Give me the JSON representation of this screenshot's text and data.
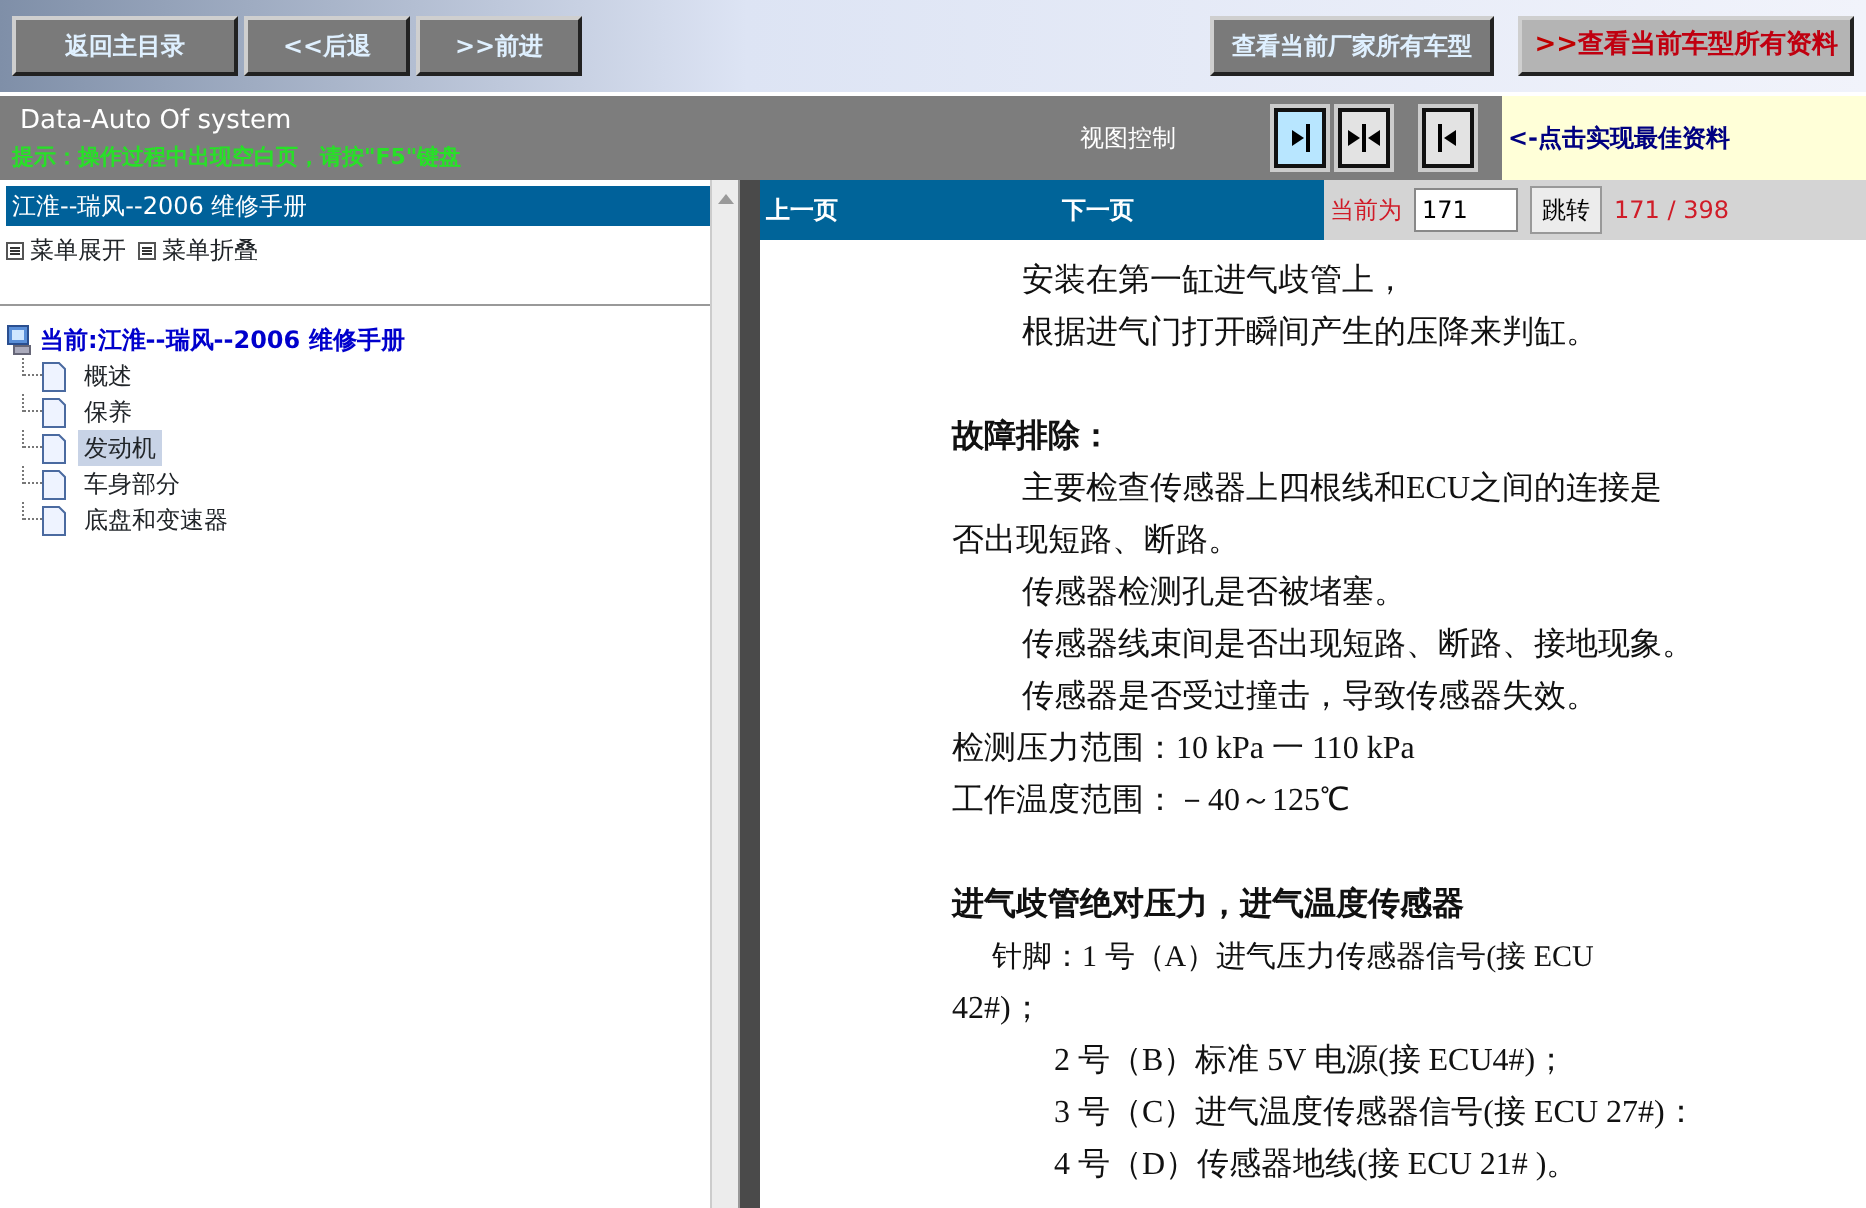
{
  "toolbar": {
    "buttons": [
      {
        "label": "返回主目录"
      },
      {
        "label": "<<后退"
      },
      {
        "label": ">>前进"
      }
    ],
    "maker_button": "查看当前厂家所有车型",
    "model_button": {
      "prefix": ">>",
      "label": "查看当前车型所有资料"
    }
  },
  "infobar": {
    "title": "Data-Auto Of system",
    "hint": "提示：操作过程中出现空白页，请按\"F5\"键盘",
    "view_label": "视图控制",
    "view_buttons": [
      {
        "kind": "right",
        "selected": true
      },
      {
        "kind": "both",
        "selected": false
      },
      {
        "kind": "left",
        "selected": false
      }
    ],
    "tip": "<-点击实现最佳资料"
  },
  "sidebar": {
    "manual_title": "江淮--瑞风--2006 维修手册",
    "actions": [
      "菜单展开",
      "菜单折叠"
    ],
    "tree": {
      "label": "当前:江淮--瑞风--2006 维修手册",
      "children": [
        {
          "label": "概述",
          "selected": false
        },
        {
          "label": "保养",
          "selected": false
        },
        {
          "label": "发动机",
          "selected": true
        },
        {
          "label": "车身部分",
          "selected": false
        },
        {
          "label": "底盘和变速器",
          "selected": false
        }
      ]
    }
  },
  "pager": {
    "prev": "上一页",
    "next": "下一页",
    "current_label": "当前为",
    "page_value": "171",
    "go_button": "跳转",
    "page_count": "171 / 398"
  },
  "document": {
    "lines": [
      {
        "kind": "indent",
        "text": "安装在第一缸进气歧管上，"
      },
      {
        "kind": "indent",
        "text": "根据进气门打开瞬间产生的压降来判缸。"
      },
      {
        "kind": "heading",
        "text": "故障排除："
      },
      {
        "kind": "indent",
        "text": "主要检查传感器上四根线和ECU之间的连接是"
      },
      {
        "kind": "plain",
        "text": "否出现短路、断路。"
      },
      {
        "kind": "indent",
        "text": "传感器检测孔是否被堵塞。"
      },
      {
        "kind": "indent",
        "text": "传感器线束间是否出现短路、断路、接地现象。"
      },
      {
        "kind": "indent",
        "text": "传感器是否受过撞击，导致传感器失效。"
      },
      {
        "kind": "plain",
        "text": "检测压力范围：10 kPa 一 110 kPa"
      },
      {
        "kind": "plain",
        "text": "工作温度范围：－40～125℃"
      },
      {
        "kind": "heading",
        "text": "进气歧管绝对压力，进气温度传感器"
      },
      {
        "kind": "lead",
        "text": "针脚：1 号（A）进气压力传感器信号(接  ECU"
      },
      {
        "kind": "plain",
        "text": "42#)；"
      },
      {
        "kind": "pin",
        "text": "2 号（B）标准 5V 电源(接 ECU4#)；"
      },
      {
        "kind": "pin",
        "text": "3 号（C）进气温度传感器信号(接 ECU 27#)："
      },
      {
        "kind": "pin",
        "text": "4 号（D）传感器地线(接 ECU 21# )。"
      }
    ]
  }
}
